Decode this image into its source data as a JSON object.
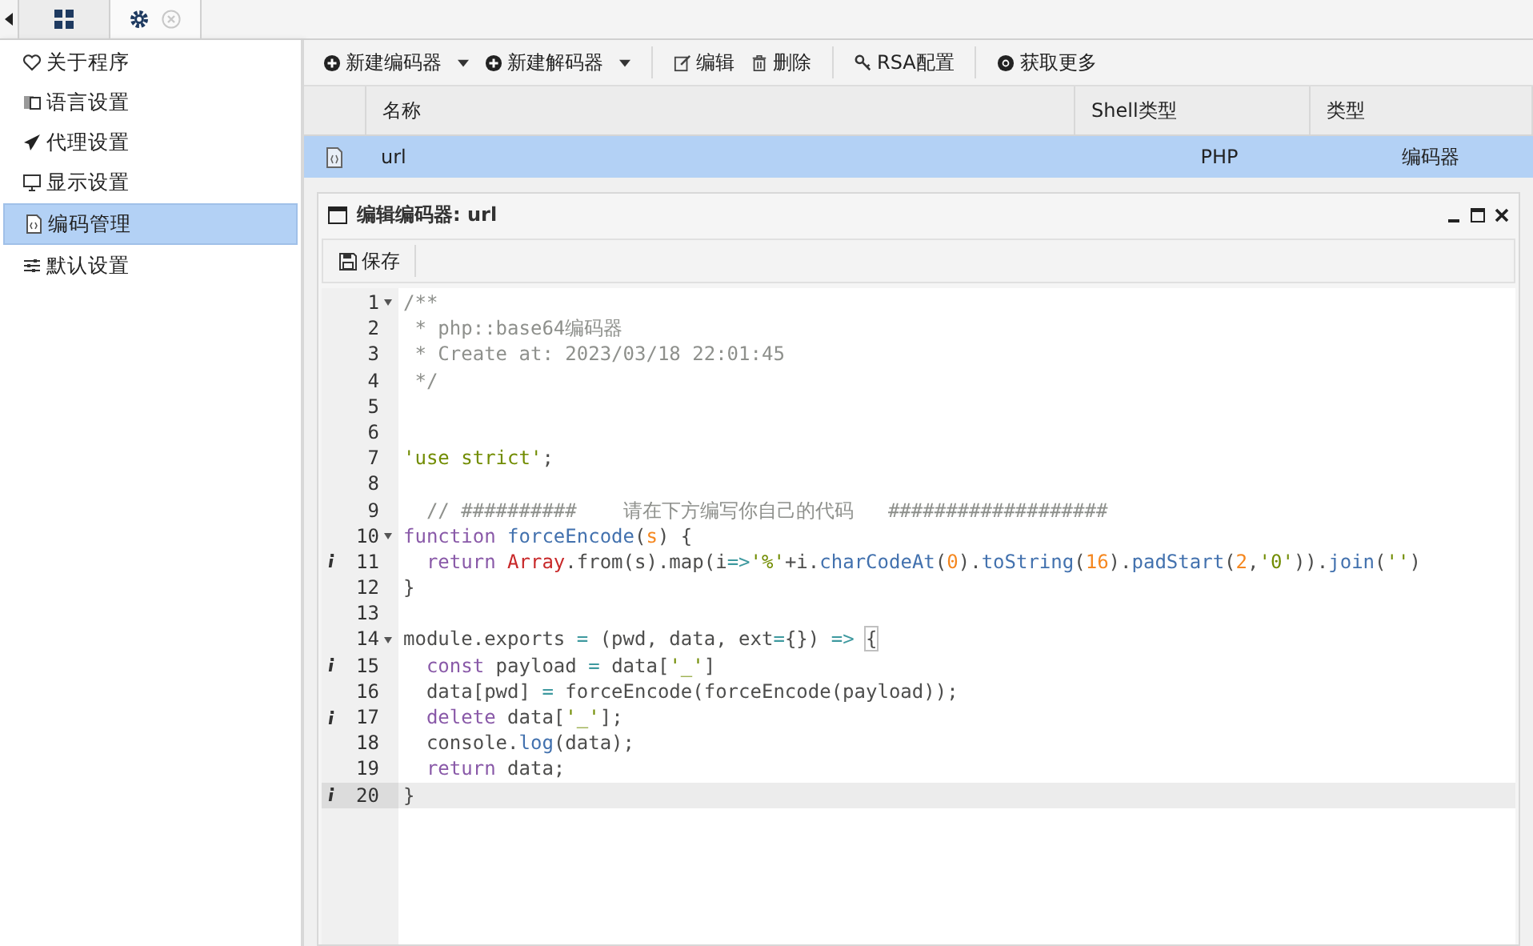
{
  "tabs": [
    {
      "selected": false,
      "closable": false
    },
    {
      "selected": true,
      "closable": true
    }
  ],
  "sidebar": {
    "items": [
      {
        "label": "关于程序",
        "selected": false
      },
      {
        "label": "语言设置",
        "selected": false
      },
      {
        "label": "代理设置",
        "selected": false
      },
      {
        "label": "显示设置",
        "selected": false
      },
      {
        "label": "编码管理",
        "selected": true
      },
      {
        "label": "默认设置",
        "selected": false
      }
    ]
  },
  "toolbar": [
    {
      "label": "新建编码器",
      "dropdown": true
    },
    {
      "label": "新建解码器",
      "dropdown": true
    },
    {
      "label": "编辑",
      "dropdown": false
    },
    {
      "label": "删除",
      "dropdown": false
    },
    {
      "label": "RSA配置",
      "dropdown": false
    },
    {
      "label": "获取更多",
      "dropdown": false
    }
  ],
  "table": {
    "columns": [
      "名称",
      "Shell类型",
      "类型"
    ],
    "rows": [
      {
        "name": "url",
        "shell_type": "PHP",
        "type": "编码器",
        "selected": true
      }
    ]
  },
  "editor_window": {
    "title": "编辑编码器: url",
    "save_label": "保存",
    "lines": [
      {
        "number": "1",
        "fold": true,
        "info": false,
        "selected": false,
        "tokens": [
          {
            "kind": "comment",
            "text": "/**"
          }
        ]
      },
      {
        "number": "2",
        "fold": false,
        "info": false,
        "selected": false,
        "tokens": [
          {
            "kind": "comment",
            "text": " * php::base64编码器"
          }
        ]
      },
      {
        "number": "3",
        "fold": false,
        "info": false,
        "selected": false,
        "tokens": [
          {
            "kind": "comment",
            "text": " * Create at: 2023/03/18 22:01:45"
          }
        ]
      },
      {
        "number": "4",
        "fold": false,
        "info": false,
        "selected": false,
        "tokens": [
          {
            "kind": "comment",
            "text": " */"
          }
        ]
      },
      {
        "number": "5",
        "fold": false,
        "info": false,
        "selected": false
      },
      {
        "number": "6",
        "fold": false,
        "info": false,
        "selected": false
      },
      {
        "number": "7",
        "fold": false,
        "info": false,
        "selected": false,
        "tokens": [
          {
            "kind": "string",
            "text": "'use strict'"
          },
          {
            "kind": "plain",
            "text": ";"
          }
        ]
      },
      {
        "number": "8",
        "fold": false,
        "info": false,
        "selected": false
      },
      {
        "number": "9",
        "fold": false,
        "info": false,
        "selected": false,
        "tokens": [
          {
            "kind": "comment",
            "text": "  // ##########    请在下方编写你自己的代码   ###################"
          }
        ]
      },
      {
        "number": "10",
        "fold": true,
        "info": false,
        "selected": false,
        "tokens": [
          {
            "kind": "keyword",
            "text": "function "
          },
          {
            "kind": "func",
            "text": "forceEncode"
          },
          {
            "kind": "plain",
            "text": "("
          },
          {
            "kind": "param",
            "text": "s"
          },
          {
            "kind": "plain",
            "text": ") {"
          }
        ]
      },
      {
        "number": "11",
        "fold": false,
        "info": true,
        "selected": false,
        "tokens": [
          {
            "kind": "keyword",
            "text": "  return "
          },
          {
            "kind": "class",
            "text": "Array"
          },
          {
            "kind": "plain",
            "text": ".from(s).map(i"
          },
          {
            "kind": "operator",
            "text": "=>"
          },
          {
            "kind": "string",
            "text": "'%'"
          },
          {
            "kind": "plain",
            "text": "+i."
          },
          {
            "kind": "func",
            "text": "charCodeAt"
          },
          {
            "kind": "plain",
            "text": "("
          },
          {
            "kind": "number",
            "text": "0"
          },
          {
            "kind": "plain",
            "text": ")."
          },
          {
            "kind": "func",
            "text": "toString"
          },
          {
            "kind": "plain",
            "text": "("
          },
          {
            "kind": "number",
            "text": "16"
          },
          {
            "kind": "plain",
            "text": ")."
          },
          {
            "kind": "func",
            "text": "padStart"
          },
          {
            "kind": "plain",
            "text": "("
          },
          {
            "kind": "number",
            "text": "2"
          },
          {
            "kind": "plain",
            "text": ","
          },
          {
            "kind": "string",
            "text": "'0'"
          },
          {
            "kind": "plain",
            "text": "))."
          },
          {
            "kind": "func",
            "text": "join"
          },
          {
            "kind": "plain",
            "text": "("
          },
          {
            "kind": "string",
            "text": "''"
          },
          {
            "kind": "plain",
            "text": ")"
          }
        ]
      },
      {
        "number": "12",
        "fold": false,
        "info": false,
        "selected": false,
        "tokens": [
          {
            "kind": "plain",
            "text": "}"
          }
        ]
      },
      {
        "number": "13",
        "fold": false,
        "info": false,
        "selected": false
      },
      {
        "number": "14",
        "fold": true,
        "info": false,
        "selected": false,
        "tokens": [
          {
            "kind": "plain",
            "text": "module.exports "
          },
          {
            "kind": "operator",
            "text": "="
          },
          {
            "kind": "plain",
            "text": " (pwd, data, ext"
          },
          {
            "kind": "operator",
            "text": "="
          },
          {
            "kind": "plain",
            "text": "{}) "
          },
          {
            "kind": "operator",
            "text": "=> "
          },
          {
            "kind": "bracket",
            "text": "{"
          }
        ]
      },
      {
        "number": "15",
        "fold": false,
        "info": true,
        "selected": false,
        "tokens": [
          {
            "kind": "keyword",
            "text": "  const"
          },
          {
            "kind": "plain",
            "text": " payload "
          },
          {
            "kind": "operator",
            "text": "="
          },
          {
            "kind": "plain",
            "text": " data["
          },
          {
            "kind": "string",
            "text": "'_'"
          },
          {
            "kind": "plain",
            "text": "]"
          }
        ]
      },
      {
        "number": "16",
        "fold": false,
        "info": false,
        "selected": false,
        "tokens": [
          {
            "kind": "plain",
            "text": "  data[pwd] "
          },
          {
            "kind": "operator",
            "text": "="
          },
          {
            "kind": "plain",
            "text": " forceEncode(forceEncode(payload));"
          }
        ]
      },
      {
        "number": "17",
        "fold": false,
        "info": true,
        "selected": false,
        "tokens": [
          {
            "kind": "keyword",
            "text": "  delete"
          },
          {
            "kind": "plain",
            "text": " data["
          },
          {
            "kind": "string",
            "text": "'_'"
          },
          {
            "kind": "plain",
            "text": "];"
          }
        ]
      },
      {
        "number": "18",
        "fold": false,
        "info": false,
        "selected": false,
        "tokens": [
          {
            "kind": "plain",
            "text": "  console."
          },
          {
            "kind": "func",
            "text": "log"
          },
          {
            "kind": "plain",
            "text": "(data);"
          }
        ]
      },
      {
        "number": "19",
        "fold": false,
        "info": false,
        "selected": false,
        "tokens": [
          {
            "kind": "keyword",
            "text": "  return"
          },
          {
            "kind": "plain",
            "text": " data;"
          }
        ]
      },
      {
        "number": "20",
        "fold": false,
        "info": true,
        "selected": true,
        "tokens": [
          {
            "kind": "plain",
            "text": "}"
          }
        ]
      }
    ]
  }
}
